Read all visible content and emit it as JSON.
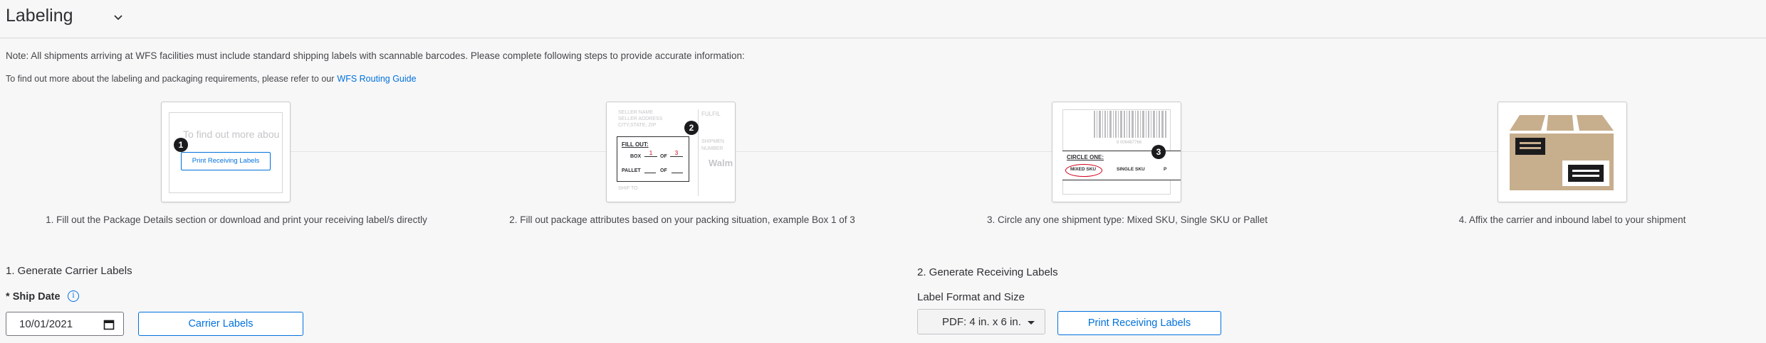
{
  "header": {
    "title": "Labeling"
  },
  "note": "Note: All shipments arriving at WFS facilities must include standard shipping labels with scannable barcodes. Please complete following steps to provide accurate information:",
  "refer": {
    "text": "To find out more about the labeling and packaging requirements, please refer to our",
    "link": "WFS Routing Guide"
  },
  "steps": [
    {
      "caption": "1. Fill out the Package Details section or download and print your receiving label/s directly",
      "badge": "1",
      "inner_text": "To find out more abou",
      "inner_button": "Print Receiving Labels"
    },
    {
      "caption": "2. Fill out package attributes based on your packing situation, example Box 1 of 3",
      "badge": "2",
      "seller_name": "SELLER NAME",
      "seller_address": "SELLER ADDRESS",
      "city_line": "CITY,STATE, ZIP",
      "fill_out": "FILL OUT:",
      "box": "BOX",
      "of": "OF",
      "box_num": "1",
      "box_total": "3",
      "pallet": "PALLET",
      "ship_to": "SHIP TO",
      "fulfil": "FULFIL",
      "shipmen": "SHIPMEN",
      "number": "NUMBER",
      "walm": "Walm"
    },
    {
      "caption": "3. Circle any one shipment type: Mixed SKU, Single SKU or Pallet",
      "badge": "3",
      "circle_one": "CIRCLE ONE:",
      "mixed_sku": "MIXED SKU",
      "single_sku": "SINGLE SKU",
      "pallet_p": "P",
      "barcode_number": "8 009487766"
    },
    {
      "caption": "4. Affix the carrier and inbound label to your shipment"
    }
  ],
  "carrier": {
    "section_title": "1. Generate Carrier Labels",
    "ship_date_label": "Ship Date",
    "required_mark": "*",
    "info_icon": "i",
    "ship_date_value": "10/01/2021",
    "button": "Carrier Labels"
  },
  "receiving": {
    "section_title": "2. Generate Receiving Labels",
    "format_label": "Label Format and Size",
    "format_value": "PDF: 4 in. x 6 in.",
    "button": "Print Receiving Labels"
  },
  "colors": {
    "accent": "#0071dc",
    "text": "#2e2f32",
    "box": "#c7ae8d",
    "label_red": "#d0021b"
  },
  "icons": [
    "chevron-down-icon",
    "info-icon",
    "calendar-icon",
    "caret-down-icon"
  ]
}
